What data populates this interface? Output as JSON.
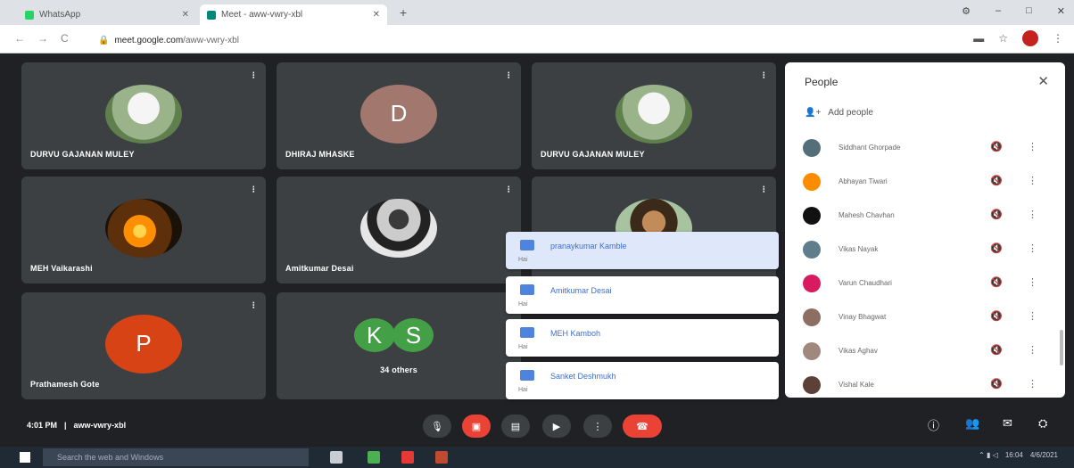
{
  "browser": {
    "tabs": [
      {
        "label": "WhatsApp",
        "favicon_color": "#25d366"
      },
      {
        "label": "Meet - aww-vwry-xbl",
        "favicon_color": "#00897b"
      }
    ],
    "new_tab": "+",
    "window_controls": [
      "⚙",
      "–",
      "□",
      "✕"
    ],
    "nav": [
      "←",
      "→",
      "C"
    ],
    "url_host": "meet.google.com",
    "url_path": "/aww-vwry-xbl"
  },
  "tiles": [
    {
      "name": "DURVU GAJANAN MULEY",
      "avatar": "photo"
    },
    {
      "name": "DHIRAJ MHASKE",
      "avatar": "letter",
      "letter": "D",
      "color": "#a1776e"
    },
    {
      "name": "DURVU GAJANAN MULEY",
      "avatar": "photo"
    },
    {
      "name": "MEH Vaikarashi",
      "avatar": "fire"
    },
    {
      "name": "Amitkumar Desai",
      "avatar": "suit"
    },
    {
      "name": "",
      "avatar": "beard"
    },
    {
      "name": "Prathamesh Gote",
      "avatar": "letter",
      "letter": "P",
      "color": "#d84315"
    },
    {
      "name": "34 others",
      "avatar": "group"
    }
  ],
  "others": {
    "k": "K",
    "s": "S",
    "color": "#43a047"
  },
  "chat_popups": [
    {
      "name": "pranaykumar Kamble",
      "sub": "Hai"
    },
    {
      "name": "Amitkumar Desai",
      "sub": "Hai"
    },
    {
      "name": "MEH Kamboh",
      "sub": "Hai"
    },
    {
      "name": "Sanket Deshmukh",
      "sub": "Hai"
    }
  ],
  "people_panel": {
    "title": "People",
    "close": "✕",
    "add_people": "Add people",
    "participants": [
      {
        "name": "Siddhant Ghorpade",
        "color": "#546e7a"
      },
      {
        "name": "Abhayan Tiwari",
        "color": "#fb8c00"
      },
      {
        "name": "Mahesh Chavhan",
        "color": "#111111"
      },
      {
        "name": "Vikas Nayak",
        "color": "#607d8b"
      },
      {
        "name": "Varun Chaudhari",
        "color": "#d81b60"
      },
      {
        "name": "Vinay Bhagwat",
        "color": "#8d6e63"
      },
      {
        "name": "Vikas Aghav",
        "color": "#a1887f"
      },
      {
        "name": "Vishal Kale",
        "color": "#5d4037"
      }
    ]
  },
  "bottom_bar": {
    "time": "4:01 PM",
    "separator": "|",
    "meeting_code": "aww-vwry-xbl"
  },
  "taskbar": {
    "search_placeholder": "Search the web and Windows",
    "tray_time": "16:04",
    "tray_date": "4/6/2021"
  }
}
